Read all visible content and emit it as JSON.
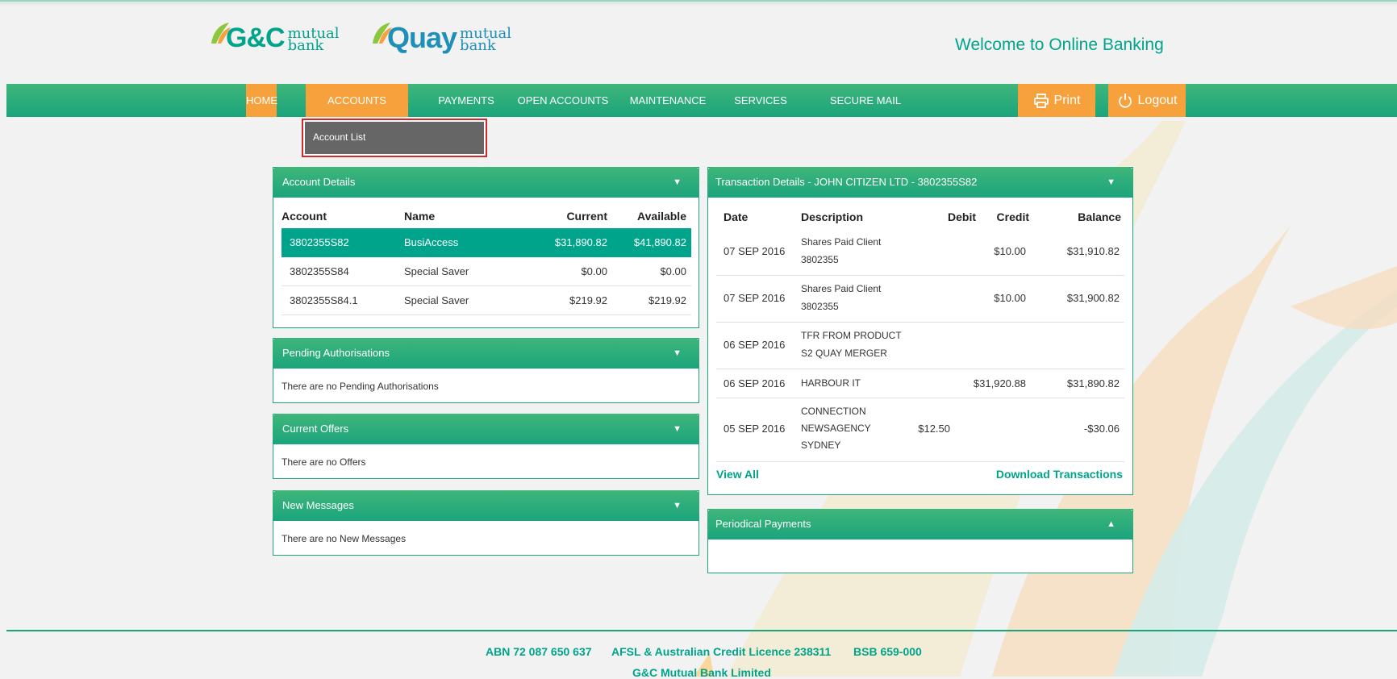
{
  "header": {
    "brand1": {
      "big": "G&C",
      "small1": "mutual",
      "small2": "bank"
    },
    "brand2": {
      "big": "Quay",
      "small1": "mutual",
      "small2": "bank"
    },
    "welcome": "Welcome to Online Banking"
  },
  "nav": {
    "home": "HOME",
    "accounts": "ACCOUNTS",
    "payments": "PAYMENTS",
    "open_accounts": "OPEN ACCOUNTS",
    "maintenance": "MAINTENANCE",
    "services": "SERVICES",
    "secure_mail": "SECURE MAIL",
    "print": "Print",
    "logout": "Logout"
  },
  "dropdown": {
    "account_list": "Account List"
  },
  "account_details": {
    "title": "Account Details",
    "headers": {
      "account": "Account",
      "name": "Name",
      "current": "Current",
      "available": "Available"
    },
    "rows": [
      {
        "account": "3802355S82",
        "name": "BusiAccess",
        "current": "$31,890.82",
        "available": "$41,890.82"
      },
      {
        "account": "3802355S84",
        "name": "Special Saver",
        "current": "$0.00",
        "available": "$0.00"
      },
      {
        "account": "3802355S84.1",
        "name": "Special Saver",
        "current": "$219.92",
        "available": "$219.92"
      }
    ]
  },
  "pending": {
    "title": "Pending Authorisations",
    "text": "There are no Pending Authorisations"
  },
  "offers": {
    "title": "Current Offers",
    "text": "There are no Offers"
  },
  "messages": {
    "title": "New Messages",
    "text": "There are no New Messages"
  },
  "transactions": {
    "title": "Transaction Details - JOHN CITIZEN LTD - 3802355S82",
    "headers": {
      "date": "Date",
      "description": "Description",
      "debit": "Debit",
      "credit": "Credit",
      "balance": "Balance"
    },
    "rows": [
      {
        "date": "07 SEP 2016",
        "desc1": "Shares Paid Client",
        "desc2": "3802355",
        "desc3": "",
        "debit": "",
        "credit": "$10.00",
        "balance": "$31,910.82"
      },
      {
        "date": "07 SEP 2016",
        "desc1": "Shares Paid Client",
        "desc2": "3802355",
        "desc3": "",
        "debit": "",
        "credit": "$10.00",
        "balance": "$31,900.82"
      },
      {
        "date": "06 SEP 2016",
        "desc1": "TFR FROM PRODUCT",
        "desc2": "S2 QUAY MERGER",
        "desc3": "",
        "debit": "",
        "credit": "",
        "balance": ""
      },
      {
        "date": "06 SEP 2016",
        "desc1": "HARBOUR IT",
        "desc2": "",
        "desc3": "",
        "debit": "",
        "credit": "$31,920.88",
        "balance": "$31,890.82"
      },
      {
        "date": "05 SEP 2016",
        "desc1": "CONNECTION",
        "desc2": "NEWSAGENCY",
        "desc3": "SYDNEY",
        "debit": "$12.50",
        "credit": "",
        "balance": "-$30.06"
      }
    ],
    "view_all": "View All",
    "download": "Download Transactions"
  },
  "periodical": {
    "title": "Periodical Payments"
  },
  "footer": {
    "abn": "ABN 72 087 650 637",
    "afsl": "AFSL & Australian Credit Licence 238311",
    "bsb": "BSB 659-000",
    "bank": "G&C Mutual Bank Limited"
  },
  "colors": {
    "brand_green": "#00a48a",
    "nav_orange": "#f7a13c",
    "selected_outline": "#d0282e"
  }
}
